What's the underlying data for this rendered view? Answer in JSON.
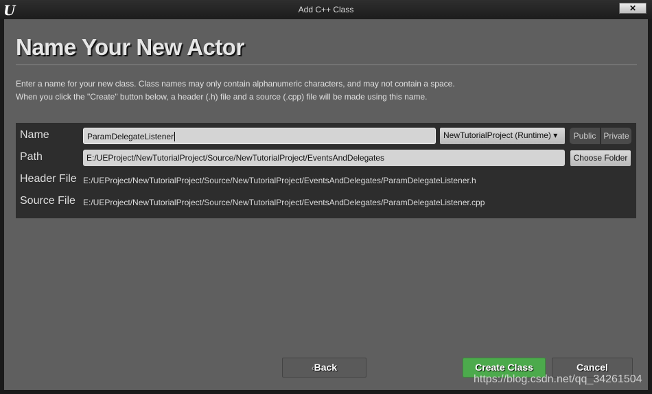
{
  "window": {
    "title": "Add C++ Class",
    "logo": "U",
    "close": "✕"
  },
  "heading": "Name Your New Actor",
  "description": [
    "Enter a name for your new class. Class names may only contain alphanumeric characters, and may not contain a space.",
    "When you click the \"Create\" button below, a header (.h) file and a source (.cpp) file will be made using this name."
  ],
  "form": {
    "name_label": "Name",
    "name_value": "ParamDelegateListener",
    "module": "NewTutorialProject (Runtime)",
    "public": "Public",
    "private": "Private",
    "path_label": "Path",
    "path_value": "E:/UEProject/NewTutorialProject/Source/NewTutorialProject/EventsAndDelegates",
    "choose_folder": "Choose Folder",
    "header_label": "Header File",
    "header_value": "E:/UEProject/NewTutorialProject/Source/NewTutorialProject/EventsAndDelegates/ParamDelegateListener.h",
    "source_label": "Source File",
    "source_value": "E:/UEProject/NewTutorialProject/Source/NewTutorialProject/EventsAndDelegates/ParamDelegateListener.cpp"
  },
  "footer": {
    "back": "Back",
    "create": "Create Class",
    "cancel": "Cancel",
    "create_color": "#4caa4c"
  },
  "watermark": "https://blog.csdn.net/qq_34261504"
}
